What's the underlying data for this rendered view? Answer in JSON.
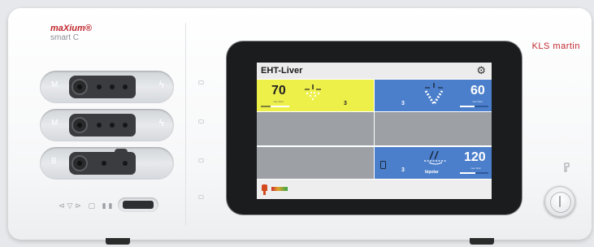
{
  "branding": {
    "product_name": "maXium®",
    "product_model": "smart C",
    "manufacturer": "KLS martin"
  },
  "sockets": [
    {
      "label": "M",
      "icon": "lightning-icon"
    },
    {
      "label": "M",
      "icon": "lightning-icon"
    },
    {
      "label": "B",
      "icon": ""
    }
  ],
  "screen": {
    "title": "EHT-Liver",
    "settings_icon": "gear-icon",
    "channels": [
      {
        "position": "top-left",
        "power": "70",
        "power_sublabel": "max Watt",
        "effect": "3",
        "color": "#eef04a",
        "mode_icon": "cut-spray-icon",
        "level": 0.35
      },
      {
        "position": "top-right",
        "power": "60",
        "power_sublabel": "max Watt",
        "effect": "3",
        "color": "#4b7fcb",
        "mode_icon": "spray-coag-icon",
        "level": 0.5
      },
      {
        "position": "bottom-right",
        "power": "120",
        "power_sublabel": "max Watt",
        "effect": "3",
        "mode_label": "bipolar",
        "color": "#4b7fcb",
        "mode_icon": "bipolar-icon",
        "level": 0.55
      }
    ],
    "footer": {
      "pedal_icon": "footswitch-icon",
      "gauge_icon": "neutral-electrode-gauge-icon"
    }
  },
  "controls": {
    "power_icon": "power-icon",
    "status_icon": "tool-icon"
  },
  "colors": {
    "brand_red": "#c0282e",
    "cut_yellow": "#eef04a",
    "coag_blue": "#4b7fcb"
  }
}
